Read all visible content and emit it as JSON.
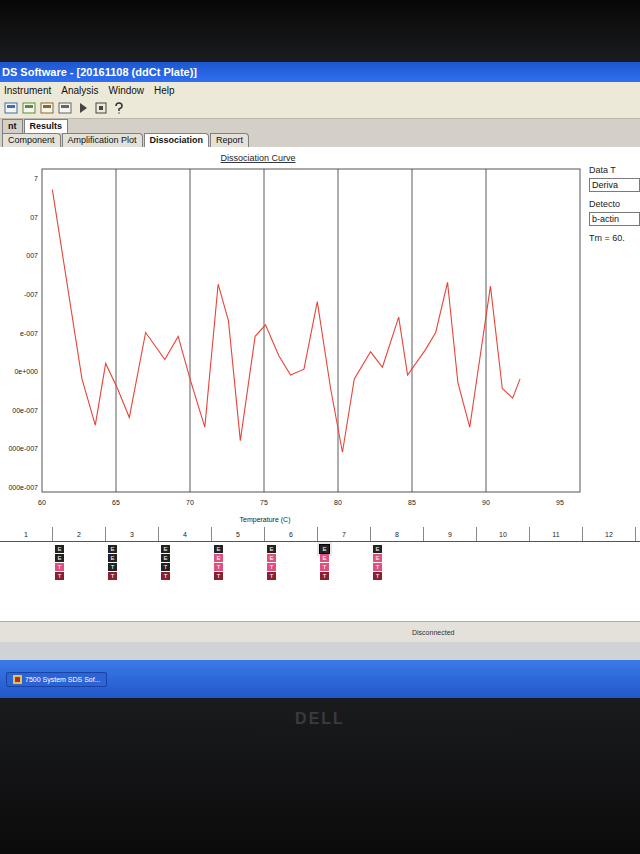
{
  "window": {
    "title": "DS Software - [20161108 (ddCt Plate)]"
  },
  "menu": [
    "Instrument",
    "Analysis",
    "Window",
    "Help"
  ],
  "tabs": [
    {
      "label": "nt",
      "selected": false
    },
    {
      "label": "Results",
      "selected": true
    }
  ],
  "subtabs": [
    {
      "label": "Component",
      "selected": false
    },
    {
      "label": "Amplification Plot",
      "selected": false
    },
    {
      "label": "Dissociation",
      "selected": true
    },
    {
      "label": "Report",
      "selected": false
    }
  ],
  "chart": {
    "title": "Dissociation Curve",
    "x_axis": {
      "title": "Temperature (C)",
      "min": 60,
      "max": 96.35,
      "ticks": [
        "60",
        "65",
        "70",
        "75",
        "80",
        "85",
        "90",
        "95"
      ]
    },
    "y_axis": {
      "max": 5e-07,
      "min": -3e-07,
      "ticks": [
        "7",
        "07",
        "007",
        "-007",
        "e-007",
        "0e+000",
        "00e-007",
        "000e-007",
        "000e-007"
      ]
    },
    "series": [
      {
        "x": [
          60.7,
          62.7,
          63.6,
          64.3,
          65.1,
          65.9,
          67.0,
          68.3,
          69.2,
          70.0,
          71.0,
          71.9,
          72.6,
          73.4,
          74.4,
          75.1,
          76.0,
          76.8,
          77.7,
          78.6,
          79.5,
          80.3,
          81.1,
          82.2,
          83.0,
          84.1,
          84.7,
          85.9,
          86.6,
          87.4,
          88.1,
          88.9,
          90.3,
          91.1,
          91.8,
          92.3
        ],
        "y": [
          4.7e-07,
          -2e-08,
          -1.4e-07,
          2e-08,
          -4.5e-08,
          -1.2e-07,
          1e-07,
          3e-08,
          9e-08,
          -2e-08,
          -1.45e-07,
          2.25e-07,
          1.3e-07,
          -1.8e-07,
          9e-08,
          1.2e-07,
          4e-08,
          -1e-08,
          5e-09,
          1.8e-07,
          -4.5e-08,
          -2.1e-07,
          -2e-08,
          5e-08,
          1e-08,
          1.4e-07,
          -1e-08,
          5.5e-08,
          1e-07,
          2.3e-07,
          -3e-08,
          -1.45e-07,
          2.2e-07,
          -4.5e-08,
          -7e-08,
          -2e-08
        ]
      }
    ]
  },
  "side_panel": {
    "data_type_label": "Data T",
    "data_type": "Deriva",
    "detector_label": "Detecto",
    "detector": "b-actin",
    "tm": "Tm = 60."
  },
  "plate": {
    "columns": [
      "1",
      "2",
      "3",
      "4",
      "5",
      "6",
      "7",
      "8",
      "9",
      "10",
      "11",
      "12"
    ],
    "wells": [
      {
        "column": "2",
        "markers": [
          {
            "label": "E",
            "color": "#222222",
            "selected": false
          },
          {
            "label": "E",
            "color": "#222222",
            "selected": false
          },
          {
            "label": "T",
            "color": "#e0507f",
            "selected": false
          },
          {
            "label": "T",
            "color": "#8a1f2f",
            "selected": false
          }
        ]
      },
      {
        "column": "3",
        "markers": [
          {
            "label": "E",
            "color": "#222222",
            "selected": false
          },
          {
            "label": "E",
            "color": "#222222",
            "selected": false
          },
          {
            "label": "T",
            "color": "#222222",
            "selected": false
          },
          {
            "label": "T",
            "color": "#8a1f2f",
            "selected": false
          }
        ]
      },
      {
        "column": "4",
        "markers": [
          {
            "label": "E",
            "color": "#222222",
            "selected": false
          },
          {
            "label": "E",
            "color": "#222222",
            "selected": false
          },
          {
            "label": "T",
            "color": "#222222",
            "selected": false
          },
          {
            "label": "T",
            "color": "#8a1f2f",
            "selected": false
          }
        ]
      },
      {
        "column": "5",
        "markers": [
          {
            "label": "E",
            "color": "#222222",
            "selected": false
          },
          {
            "label": "E",
            "color": "#e0507f",
            "selected": false
          },
          {
            "label": "T",
            "color": "#e0507f",
            "selected": false
          },
          {
            "label": "T",
            "color": "#8a1f2f",
            "selected": false
          }
        ]
      },
      {
        "column": "6",
        "markers": [
          {
            "label": "E",
            "color": "#222222",
            "selected": false
          },
          {
            "label": "E",
            "color": "#e0507f",
            "selected": false
          },
          {
            "label": "T",
            "color": "#e0507f",
            "selected": false
          },
          {
            "label": "T",
            "color": "#8a1f2f",
            "selected": false
          }
        ]
      },
      {
        "column": "7",
        "markers": [
          {
            "label": "E",
            "color": "#222222",
            "selected": true
          },
          {
            "label": "E",
            "color": "#e0507f",
            "selected": false
          },
          {
            "label": "T",
            "color": "#e0507f",
            "selected": false
          },
          {
            "label": "T",
            "color": "#8a1f2f",
            "selected": false
          }
        ]
      },
      {
        "column": "8",
        "markers": [
          {
            "label": "E",
            "color": "#222222",
            "selected": false
          },
          {
            "label": "E",
            "color": "#e0507f",
            "selected": false
          },
          {
            "label": "T",
            "color": "#e0507f",
            "selected": false
          },
          {
            "label": "T",
            "color": "#8a1f2f",
            "selected": false
          }
        ]
      }
    ]
  },
  "status": "Disconnected",
  "taskbar": {
    "items": [
      "7500 System SDS Sof..."
    ]
  },
  "monitor": {
    "brand": "DELL"
  }
}
